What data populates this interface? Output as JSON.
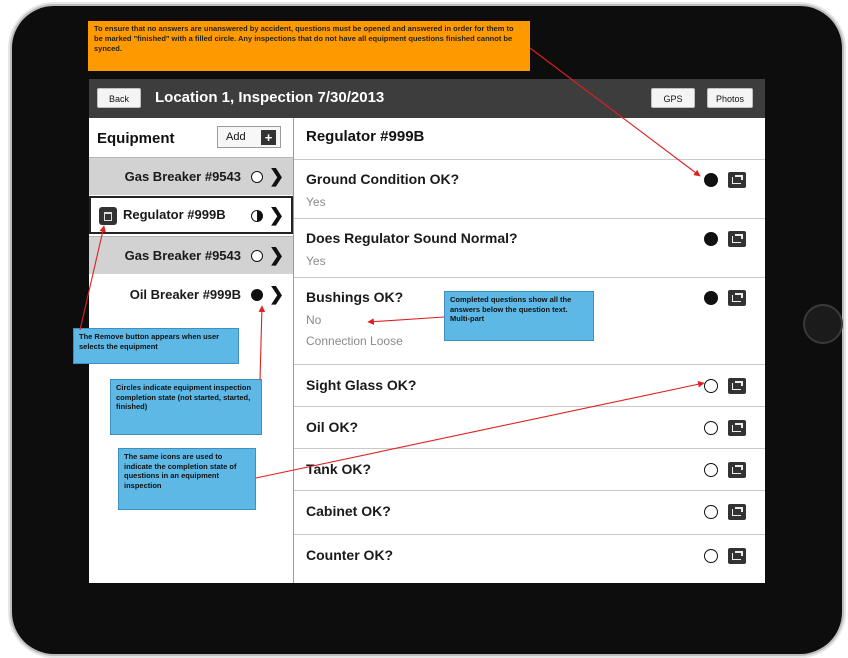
{
  "header": {
    "back_label": "Back",
    "title": "Location 1, Inspection 7/30/2013",
    "gps_label": "GPS",
    "photos_label": "Photos"
  },
  "equipment": {
    "header": "Equipment",
    "add_label": "Add",
    "add_icon": "+",
    "items": [
      {
        "label": "Gas Breaker #9543",
        "state": "not-started",
        "selected": false
      },
      {
        "label": "Regulator #999B",
        "state": "started",
        "selected": true
      },
      {
        "label": "Gas Breaker #9543",
        "state": "not-started",
        "selected": false
      },
      {
        "label": "Oil Breaker #999B",
        "state": "finished",
        "selected": false
      }
    ]
  },
  "detail": {
    "header": "Regulator #999B",
    "questions": [
      {
        "title": "Ground Condition OK?",
        "answers": [
          "Yes"
        ],
        "state": "finished"
      },
      {
        "title": "Does Regulator Sound Normal?",
        "answers": [
          "Yes"
        ],
        "state": "finished"
      },
      {
        "title": "Bushings OK?",
        "answers": [
          "No",
          "Connection Loose"
        ],
        "state": "finished"
      },
      {
        "title": "Sight Glass OK?",
        "answers": [],
        "state": "not-started"
      },
      {
        "title": "Oil OK?",
        "answers": [],
        "state": "not-started"
      },
      {
        "title": "Tank OK?",
        "answers": [],
        "state": "not-started"
      },
      {
        "title": "Cabinet OK?",
        "answers": [],
        "state": "not-started"
      },
      {
        "title": "Counter OK?",
        "answers": [],
        "state": "not-started"
      }
    ]
  },
  "annotations": {
    "top": "To ensure that no answers are unanswered by accident, questions must be opened and answered in order for them to be marked \"finished\" with a filled circle.  Any inspections that do not have all equipment questions finished cannot be synced.",
    "completed": "Completed questions show all the answers below the question text.  Multi-part",
    "remove": "The Remove button appears when user selects the equipment",
    "circles": "Circles indicate equipment inspection completion state (not started, started, finished)",
    "same_icons": "The same icons are used to indicate the completion state of questions in an equipment inspection"
  },
  "colors": {
    "annotation_orange": "#ff9900",
    "annotation_blue": "#5db8e6",
    "arrow_red": "#e02020",
    "topbar": "#3d3d3d"
  }
}
